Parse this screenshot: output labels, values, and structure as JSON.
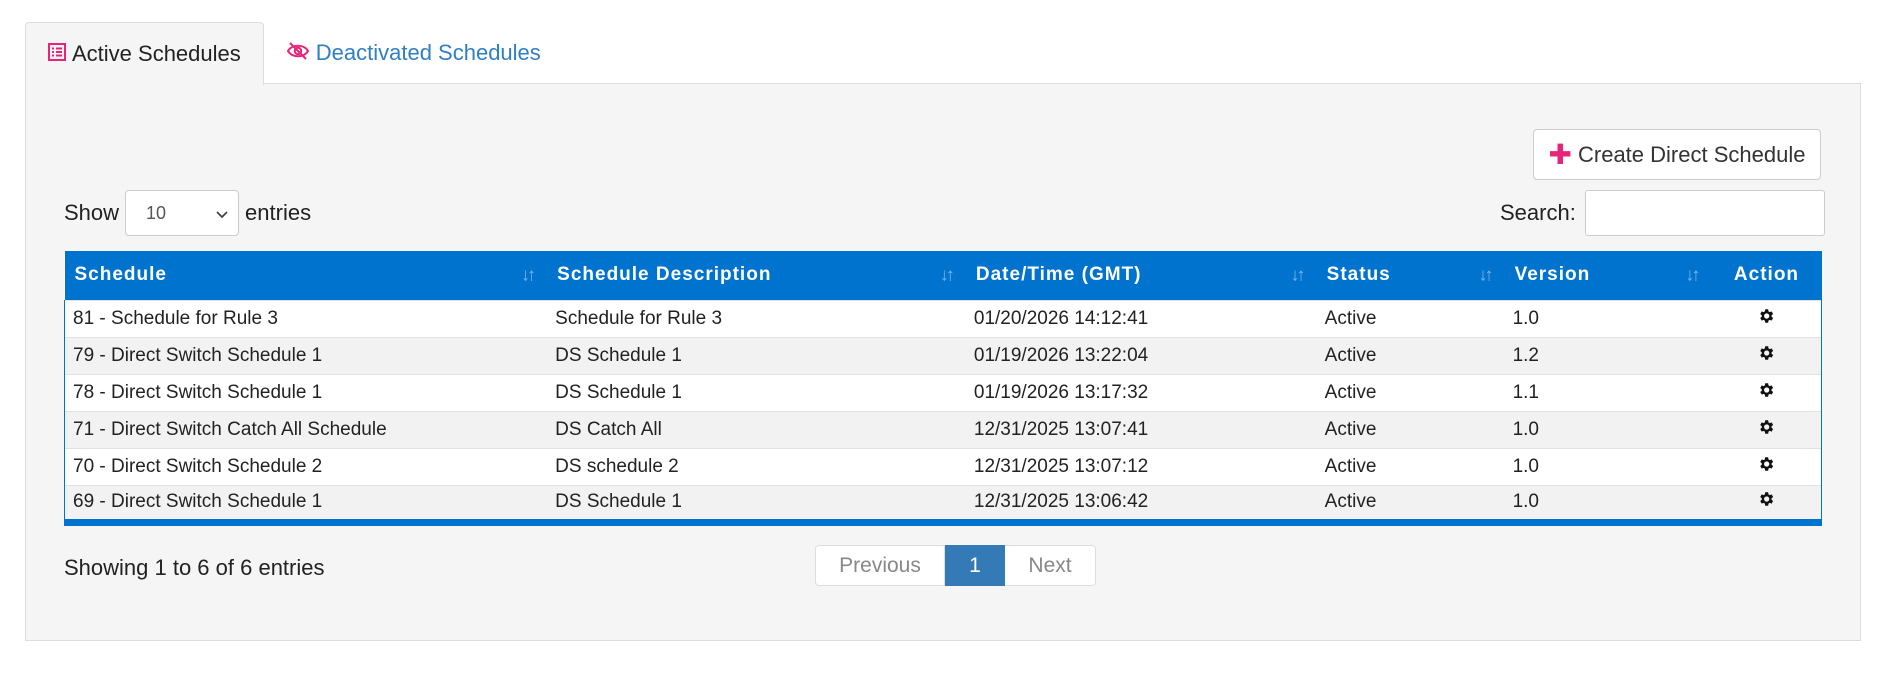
{
  "tabs": [
    {
      "label": "Active Schedules",
      "icon": "list-icon",
      "active": true
    },
    {
      "label": "Deactivated Schedules",
      "icon": "eye-slash-icon",
      "active": false
    }
  ],
  "toolbar": {
    "create_label": "Create Direct Schedule"
  },
  "length": {
    "show_label": "Show",
    "selected": "10",
    "entries_label": "entries"
  },
  "search": {
    "label": "Search:",
    "value": ""
  },
  "table": {
    "columns": [
      "Schedule",
      "Schedule Description",
      "Date/Time (GMT)",
      "Status",
      "Version",
      "Action"
    ],
    "rows": [
      {
        "schedule": "81 - Schedule for Rule 3",
        "description": "Schedule for Rule 3",
        "datetime": "01/20/2026 14:12:41",
        "status": "Active",
        "version": "1.0"
      },
      {
        "schedule": "79 - Direct Switch Schedule 1",
        "description": "DS Schedule 1",
        "datetime": "01/19/2026 13:22:04",
        "status": "Active",
        "version": "1.2"
      },
      {
        "schedule": "78 - Direct Switch Schedule 1",
        "description": "DS Schedule 1",
        "datetime": "01/19/2026 13:17:32",
        "status": "Active",
        "version": "1.1"
      },
      {
        "schedule": "71 - Direct Switch Catch All Schedule",
        "description": "DS Catch All",
        "datetime": "12/31/2025 13:07:41",
        "status": "Active",
        "version": "1.0"
      },
      {
        "schedule": "70 - Direct Switch Schedule 2",
        "description": "DS schedule 2",
        "datetime": "12/31/2025 13:07:12",
        "status": "Active",
        "version": "1.0"
      },
      {
        "schedule": "69 - Direct Switch Schedule 1",
        "description": "DS Schedule 1",
        "datetime": "12/31/2025 13:06:42",
        "status": "Active",
        "version": "1.0"
      }
    ]
  },
  "info": "Showing 1 to 6 of 6 entries",
  "pagination": {
    "previous": "Previous",
    "current": "1",
    "next": "Next"
  },
  "colors": {
    "header": "#0073cf",
    "accent_pink": "#e8237a",
    "link": "#2f7fc6",
    "page_active": "#337ab7"
  }
}
